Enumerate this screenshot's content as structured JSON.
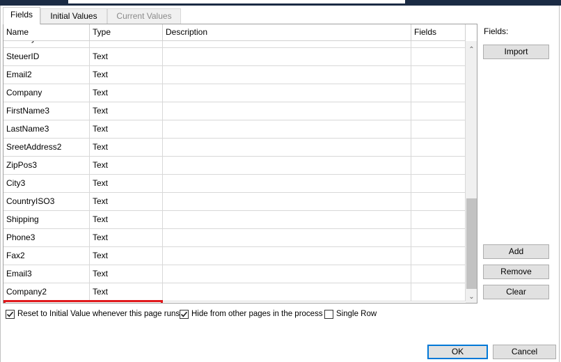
{
  "tabs": [
    {
      "label": "Fields",
      "state": "active"
    },
    {
      "label": "Initial Values",
      "state": "normal"
    },
    {
      "label": "Current Values",
      "state": "disabled"
    }
  ],
  "grid": {
    "columns": [
      "Name",
      "Type",
      "Description",
      "Fields"
    ],
    "partial_row_top": {
      "name": "Country",
      "type": ""
    },
    "rows": [
      {
        "name": "SteuerID",
        "type": "Text"
      },
      {
        "name": "Email2",
        "type": "Text"
      },
      {
        "name": "Company",
        "type": "Text"
      },
      {
        "name": "FirstName3",
        "type": "Text"
      },
      {
        "name": "LastName3",
        "type": "Text"
      },
      {
        "name": "SreetAddress2",
        "type": "Text"
      },
      {
        "name": "ZipPos3",
        "type": "Text"
      },
      {
        "name": "City3",
        "type": "Text"
      },
      {
        "name": "CountryISO3",
        "type": "Text"
      },
      {
        "name": "Shipping",
        "type": "Text"
      },
      {
        "name": "Phone3",
        "type": "Text"
      },
      {
        "name": "Fax2",
        "type": "Text"
      },
      {
        "name": "Email3",
        "type": "Text"
      },
      {
        "name": "Company2",
        "type": "Text"
      }
    ],
    "highlight_color": "#e0191c"
  },
  "side_panel": {
    "fields_label": "Fields:",
    "import_label": "Import",
    "add_label": "Add",
    "remove_label": "Remove",
    "clear_label": "Clear"
  },
  "options": {
    "reset_label": "Reset to Initial Value whenever this page runs",
    "reset_checked": true,
    "hide_label": "Hide from other pages in the process",
    "hide_checked": true,
    "single_row_label": "Single Row",
    "single_row_checked": false
  },
  "footer": {
    "ok_label": "OK",
    "cancel_label": "Cancel"
  },
  "colors": {
    "accent": "#0078d7",
    "title_strip": "#1b2b44"
  }
}
